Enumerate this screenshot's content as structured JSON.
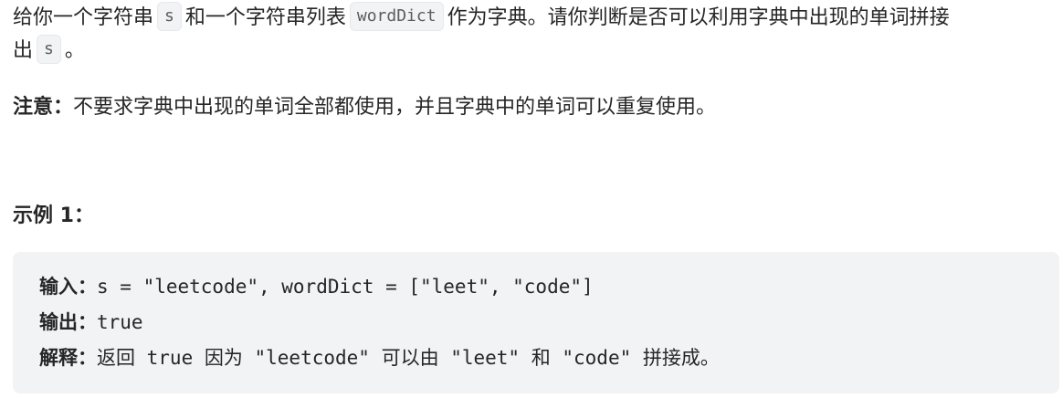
{
  "description": {
    "part1": "给你一个字符串",
    "code_s": "s",
    "part2": "和一个字符串列表",
    "code_wordDict": "wordDict",
    "part3": "作为字典。请你判断是否可以利用字典中出现的单词拼接",
    "part4": "出",
    "code_s2": "s",
    "part5": "。"
  },
  "note": {
    "label": "注意：",
    "text": "不要求字典中出现的单词全部都使用，并且字典中的单词可以重复使用。"
  },
  "example1": {
    "title": "示例 1：",
    "input_label": "输入：",
    "input_value": "s = \"leetcode\", wordDict = [\"leet\", \"code\"]",
    "output_label": "输出：",
    "output_value": "true",
    "explain_label": "解释：",
    "explain_parts": {
      "a": "返回",
      "b": " true ",
      "c": "因为",
      "d": " \"leetcode\" ",
      "e": "可以由",
      "f": " \"leet\" ",
      "g": "和",
      "h": " \"code\" ",
      "i": "拼接成。"
    }
  }
}
